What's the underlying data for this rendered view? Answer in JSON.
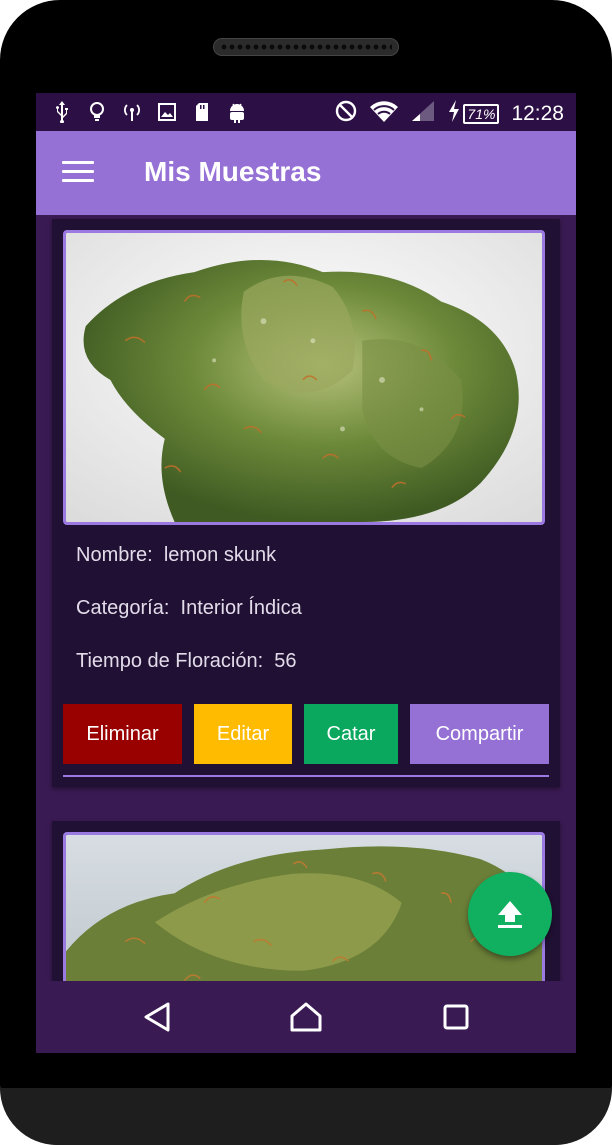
{
  "statusbar": {
    "icons_left": [
      "usb-icon",
      "lightbulb-icon",
      "hotspot-icon",
      "image-icon",
      "sd-card-icon",
      "android-icon"
    ],
    "icons_right": [
      "do-not-disturb-icon",
      "wifi-icon",
      "signal-icon",
      "charging-icon"
    ],
    "battery": "71%",
    "time": "12:28"
  },
  "appbar": {
    "title": "Mis Muestras",
    "menu_icon": "hamburger-menu-icon"
  },
  "cards": [
    {
      "fields": [
        {
          "label": "Nombre:",
          "value": "lemon skunk"
        },
        {
          "label": "Categoría:",
          "value": "Interior Índica"
        },
        {
          "label": "Tiempo de Floración:",
          "value": "56"
        }
      ],
      "buttons": {
        "delete": "Eliminar",
        "edit": "Editar",
        "taste": "Catar",
        "share": "Compartir"
      }
    }
  ],
  "fab": {
    "icon": "upload-icon"
  },
  "navbar": {
    "back": "back-icon",
    "home": "home-icon",
    "recent": "recent-apps-icon"
  },
  "colors": {
    "appbar": "#9571d6",
    "statusbar": "#2c0f45",
    "background": "#3a1a52",
    "card": "#201033",
    "delete": "#990000",
    "edit": "#ffbb00",
    "taste": "#0aa85e",
    "share": "#9571d6",
    "fab": "#10b060"
  }
}
